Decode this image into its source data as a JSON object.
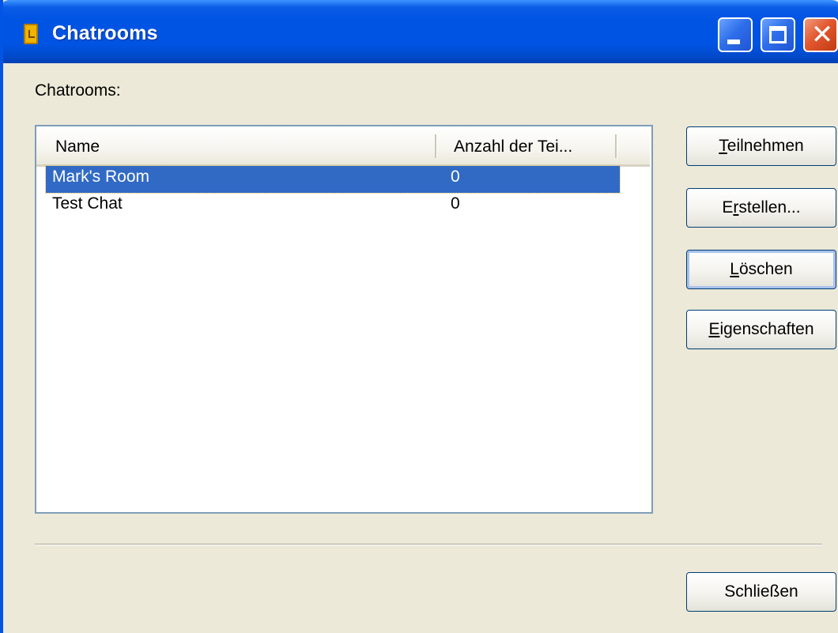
{
  "window": {
    "title": "Chatrooms"
  },
  "content": {
    "list_label": "Chatrooms:",
    "columns": [
      {
        "label": "Name"
      },
      {
        "label": "Anzahl der Tei..."
      }
    ],
    "rows": [
      {
        "name": "Mark's Room",
        "count": "0",
        "selected": true
      },
      {
        "name": "Test Chat",
        "count": "0",
        "selected": false
      }
    ]
  },
  "buttons": {
    "join": {
      "mnemonic": "T",
      "rest": "eilnehmen"
    },
    "create": {
      "pre": "E",
      "mnemonic": "r",
      "rest": "stellen..."
    },
    "delete": {
      "mnemonic": "L",
      "rest": "öschen"
    },
    "properties": {
      "mnemonic": "E",
      "rest": "igenschaften"
    },
    "close": {
      "label": "Schließen"
    }
  },
  "colors": {
    "titlebar": "#0054e3",
    "selection": "#316ac5",
    "dialog_bg": "#ece9d8",
    "close_button": "#e2582f"
  },
  "icons": [
    "chatroom-app-icon",
    "minimize-icon",
    "maximize-icon",
    "close-icon"
  ]
}
